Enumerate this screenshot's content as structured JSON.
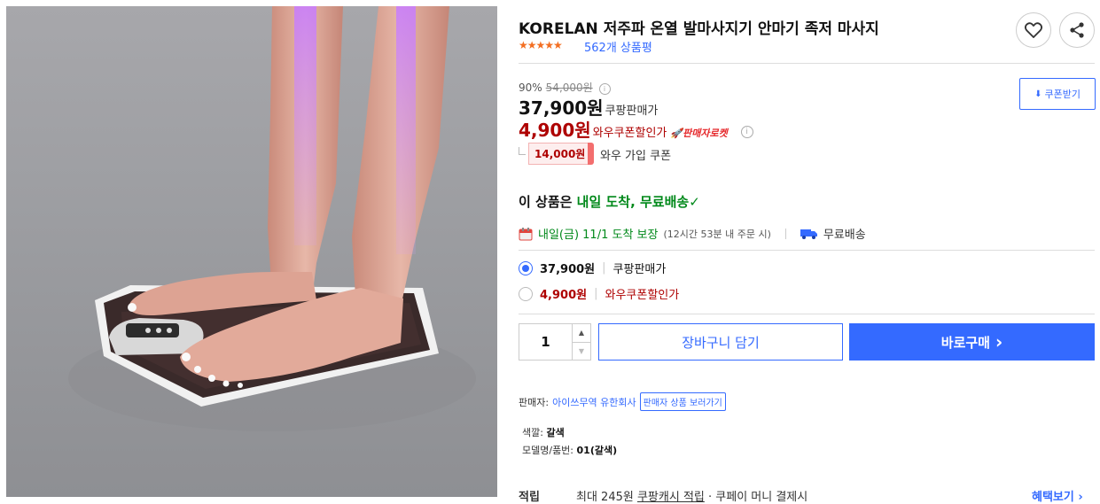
{
  "product": {
    "title": "KORELAN 저주파 온열 발마사지기 안마기 족저 마사지",
    "rating_stars": "★★★★★",
    "review_count": "562개 상품평"
  },
  "pricing": {
    "discount_rate": "90%",
    "original_price": "54,000원",
    "sale_price": "37,900원",
    "sale_label": "쿠팡판매가",
    "wow_price": "4,900원",
    "wow_label": "와우쿠폰할인가",
    "rocket_badge": "판매자로켓",
    "coupon_button": "쿠폰받기",
    "coupon_amount": "14,000원",
    "coupon_text": "와우 가입 쿠폰"
  },
  "shipping": {
    "headline_prefix": "이 상품은 ",
    "headline_strong": "내일 도착, 무료배송",
    "check": "✓",
    "arrival": "내일(금) 11/1 도착 보장",
    "arrival_note": "(12시간 53분 내 주문 시)",
    "free_shipping": "무료배송"
  },
  "options": [
    {
      "price": "37,900원",
      "label": "쿠팡판매가",
      "selected": true
    },
    {
      "price": "4,900원",
      "label": "와우쿠폰할인가",
      "selected": false
    }
  ],
  "purchase": {
    "quantity": "1",
    "cart_button": "장바구니 담기",
    "buy_button": "바로구매",
    "buy_arrow": "›"
  },
  "seller": {
    "label": "판매자:",
    "name": "아이쓰무역 유한회사",
    "link": "판매자 상품 보러가기"
  },
  "specs": [
    {
      "label": "색깔:",
      "value": "갈색"
    },
    {
      "label": "모델명/품번:",
      "value": "01(갈색)"
    }
  ],
  "reward": {
    "label": "적립",
    "prefix": "최대 245원 ",
    "link": "쿠팡캐시 적립",
    "suffix": " · 쿠페이 머니 결제시",
    "benefit": "혜택보기 ›"
  },
  "colors": {
    "accent": "#346aff",
    "wow_red": "#ae0000",
    "green": "#00891a"
  }
}
